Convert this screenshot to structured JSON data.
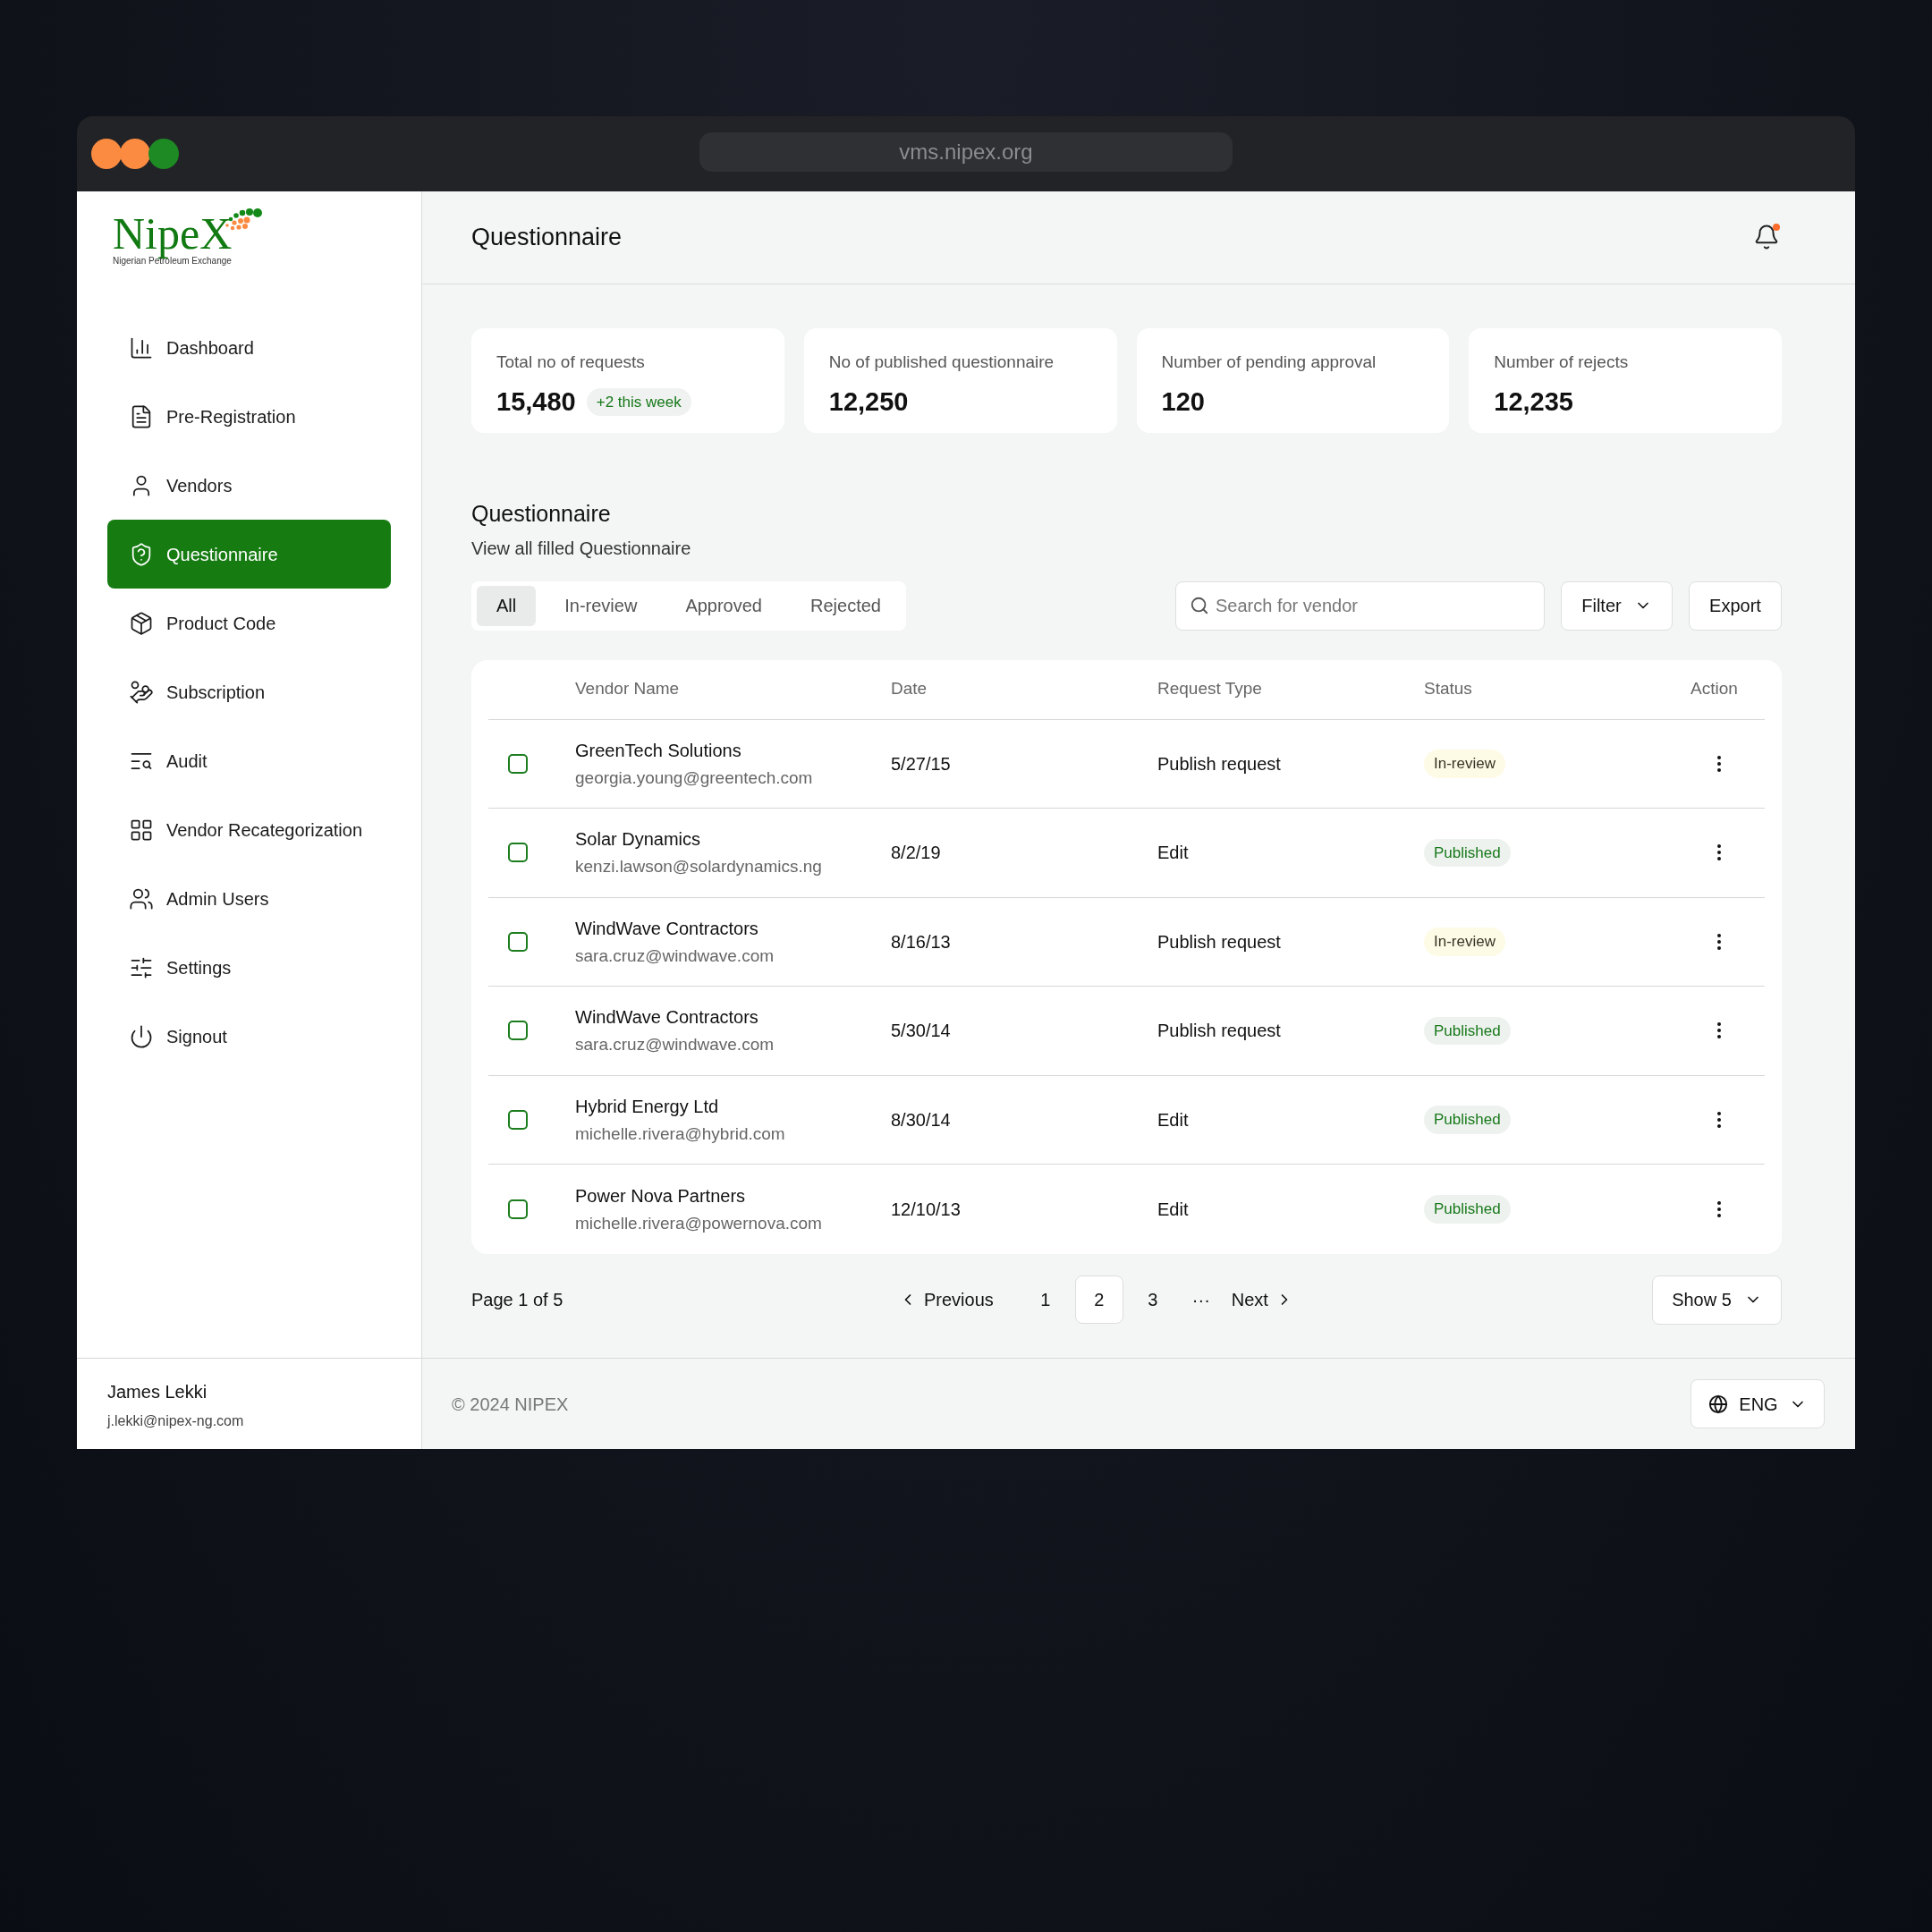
{
  "browser": {
    "url": "vms.nipex.org"
  },
  "logo": {
    "name": "NipeX",
    "tagline": "Nigerian Petroleum Exchange"
  },
  "sidebar": {
    "items": [
      {
        "label": "Dashboard",
        "selected": false
      },
      {
        "label": "Pre-Registration",
        "selected": false
      },
      {
        "label": "Vendors",
        "selected": false
      },
      {
        "label": "Questionnaire",
        "selected": true
      },
      {
        "label": "Product Code",
        "selected": false
      },
      {
        "label": "Subscription",
        "selected": false
      },
      {
        "label": "Audit",
        "selected": false
      },
      {
        "label": "Vendor Recategorization",
        "selected": false
      },
      {
        "label": "Admin Users",
        "selected": false
      },
      {
        "label": "Settings",
        "selected": false
      },
      {
        "label": "Signout",
        "selected": false
      }
    ],
    "user": {
      "name": "James Lekki",
      "email": "j.lekki@nipex-ng.com"
    }
  },
  "header": {
    "title": "Questionnaire",
    "notification_unread": true
  },
  "stats": [
    {
      "label": "Total no of requests",
      "value": "15,480",
      "badge": "+2 this week"
    },
    {
      "label": "No of published questionnaire",
      "value": "12,250"
    },
    {
      "label": "Number of pending approval",
      "value": "120"
    },
    {
      "label": "Number of rejects",
      "value": "12,235"
    }
  ],
  "section": {
    "title": "Questionnaire",
    "subtitle": "View all filled Questionnaire"
  },
  "tabs": [
    {
      "label": "All",
      "selected": true
    },
    {
      "label": "In-review",
      "selected": false
    },
    {
      "label": "Approved",
      "selected": false
    },
    {
      "label": "Rejected",
      "selected": false
    }
  ],
  "search": {
    "placeholder": "Search for vendor"
  },
  "buttons": {
    "filter": "Filter",
    "export": "Export"
  },
  "table": {
    "columns": [
      "Vendor Name",
      "Date",
      "Request Type",
      "Status",
      "Action"
    ],
    "rows": [
      {
        "checked": false,
        "name": "GreenTech Solutions",
        "email": "georgia.young@greentech.com",
        "date": "5/27/15",
        "request_type": "Publish request",
        "status": {
          "label": "In-review",
          "kind": "review"
        }
      },
      {
        "checked": false,
        "name": "Solar Dynamics",
        "email": "kenzi.lawson@solardynamics.ng",
        "date": "8/2/19",
        "request_type": "Edit",
        "status": {
          "label": "Published",
          "kind": "published"
        }
      },
      {
        "checked": false,
        "name": "WindWave Contractors",
        "email": "sara.cruz@windwave.com",
        "date": "8/16/13",
        "request_type": "Publish request",
        "status": {
          "label": "In-review",
          "kind": "review"
        }
      },
      {
        "checked": false,
        "name": "WindWave Contractors",
        "email": "sara.cruz@windwave.com",
        "date": "5/30/14",
        "request_type": "Publish request",
        "status": {
          "label": "Published",
          "kind": "published"
        }
      },
      {
        "checked": false,
        "name": "Hybrid Energy Ltd",
        "email": "michelle.rivera@hybrid.com",
        "date": "8/30/14",
        "request_type": "Edit",
        "status": {
          "label": "Published",
          "kind": "published"
        }
      },
      {
        "checked": false,
        "name": "Power Nova Partners",
        "email": "michelle.rivera@powernova.com",
        "date": "12/10/13",
        "request_type": "Edit",
        "status": {
          "label": "Published",
          "kind": "published"
        }
      }
    ]
  },
  "pagination": {
    "summary": "Page 1 of 5",
    "previous": "Previous",
    "next": "Next",
    "pages": [
      {
        "label": "1",
        "selected": false
      },
      {
        "label": "2",
        "selected": true
      },
      {
        "label": "3",
        "selected": false
      }
    ],
    "ellipsis": "···",
    "page_size": "Show 5"
  },
  "footer": {
    "copyright": "© 2024 NIPEX",
    "language": "ENG"
  }
}
